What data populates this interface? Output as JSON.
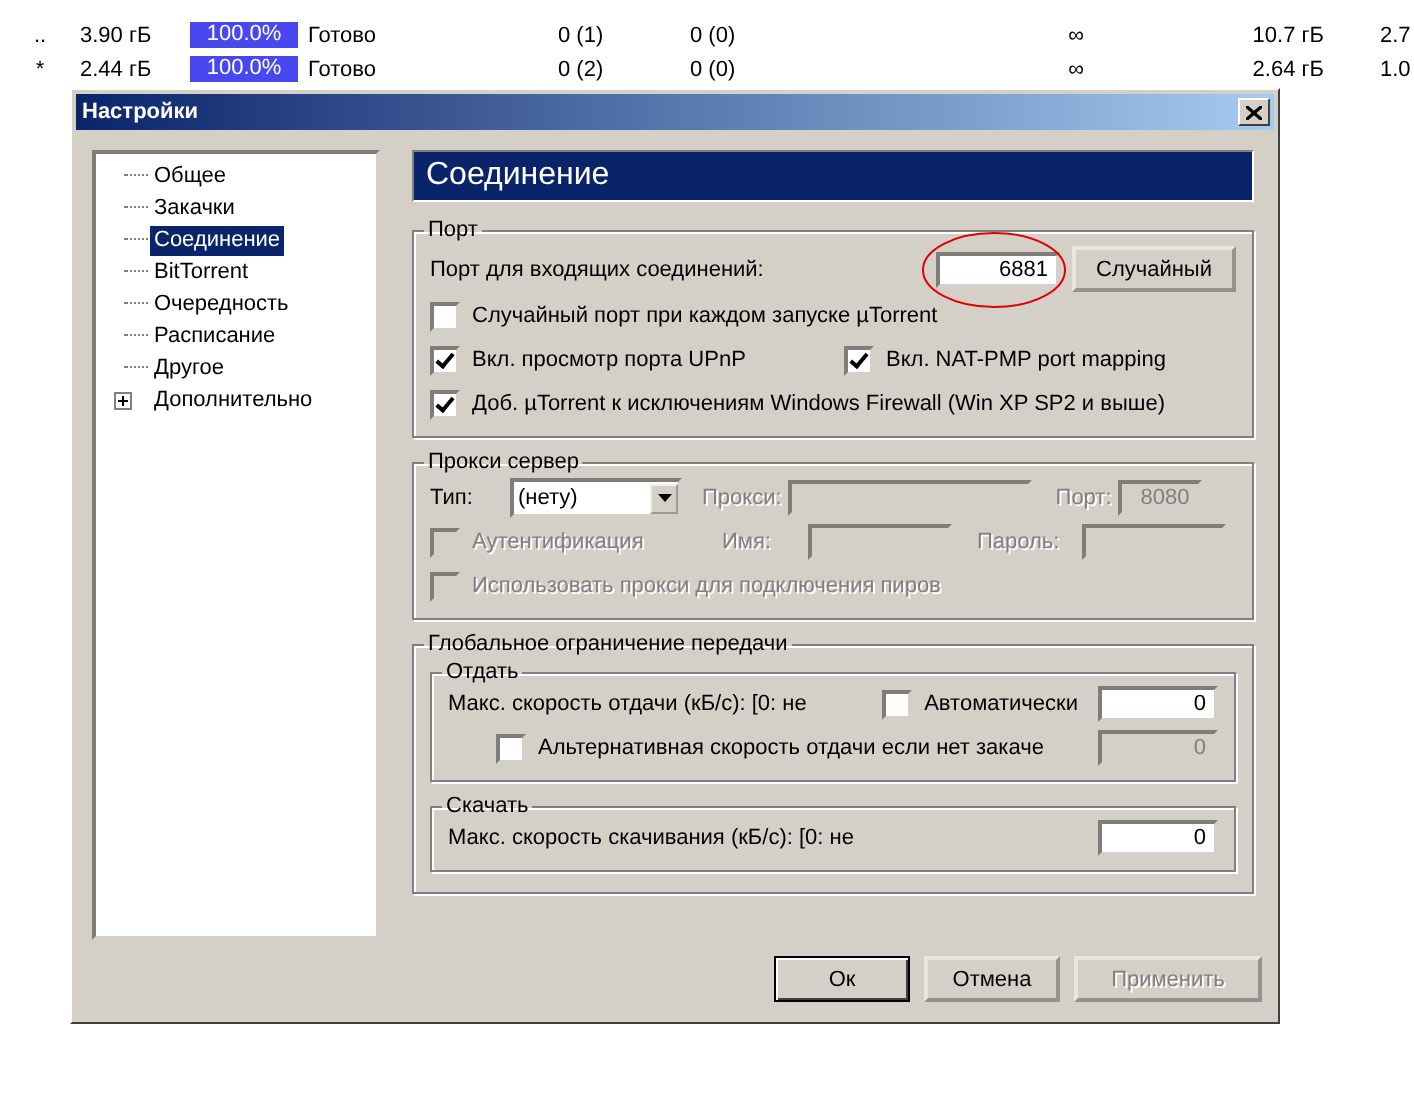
{
  "torrent_rows": [
    {
      "marker": "..",
      "size": "3.90 гБ",
      "progress": "100.0%",
      "level": 1,
      "status": "Готово",
      "seeds": "0 (1)",
      "peers": "0 (0)",
      "eta": "∞",
      "uploaded": "10.7 гБ",
      "ratio": "2.7"
    },
    {
      "marker": "*",
      "size": "2.44 гБ",
      "progress": "100.0%",
      "level": 1,
      "status": "Готово",
      "seeds": "0 (2)",
      "peers": "0 (0)",
      "eta": "∞",
      "uploaded": "2.64 гБ",
      "ratio": "1.0"
    }
  ],
  "dialog": {
    "title": "Настройки",
    "tree": [
      {
        "label": "Общее",
        "selected": false
      },
      {
        "label": "Закачки",
        "selected": false
      },
      {
        "label": "Соединение",
        "selected": true
      },
      {
        "label": "BitTorrent",
        "selected": false
      },
      {
        "label": "Очередность",
        "selected": false
      },
      {
        "label": "Расписание",
        "selected": false
      },
      {
        "label": "Другое",
        "selected": false
      },
      {
        "label": "Дополнительно",
        "selected": false,
        "expanded": false
      }
    ],
    "page_title": "Соединение",
    "port": {
      "title": "Порт",
      "port_label": "Порт для входящих соединений:",
      "port_value": "6881",
      "random_button": "Случайный",
      "options": [
        {
          "label": "Случайный порт при каждом запуске µTorrent",
          "checked": false
        },
        {
          "label": "Вкл. просмотр порта UPnP",
          "checked": true
        },
        {
          "label": "Вкл. NAT-PMP port mapping",
          "checked": true
        },
        {
          "label": "Доб. µTorrent к исключениям Windows Firewall (Win XP SP2 и выше)",
          "checked": true
        }
      ]
    },
    "proxy": {
      "title": "Прокси сервер",
      "disabled": true,
      "type_label": "Тип:",
      "type_value": "(нету)",
      "proxy_label": "Прокси:",
      "port_label": "Порт:",
      "port_value": "8080",
      "auth": {
        "label": "Аутентификация",
        "checked": false
      },
      "name_label": "Имя:",
      "password_label": "Пароль:",
      "peers": {
        "label": "Использовать прокси для подключения пиров",
        "checked": false
      }
    },
    "limits": {
      "title": "Глобальное ограничение передачи",
      "upload": {
        "title": "Отдать",
        "max_label": "Макс. скорость отдачи (кБ/с): [0: не",
        "auto": {
          "label": "Автоматически",
          "checked": false
        },
        "max_value": "0",
        "alt": {
          "label": "Альтернативная скорость отдачи если нет закаче",
          "checked": false
        },
        "alt_value": "0",
        "alt_disabled": true
      },
      "download": {
        "title": "Скачать",
        "max_label": "Макс. скорость скачивания (кБ/с): [0: не",
        "max_value": "0"
      }
    },
    "buttons": [
      {
        "label": "Ок",
        "default": true,
        "disabled": false
      },
      {
        "label": "Отмена",
        "default": false,
        "disabled": false
      },
      {
        "label": "Применить",
        "default": false,
        "disabled": true
      }
    ]
  }
}
